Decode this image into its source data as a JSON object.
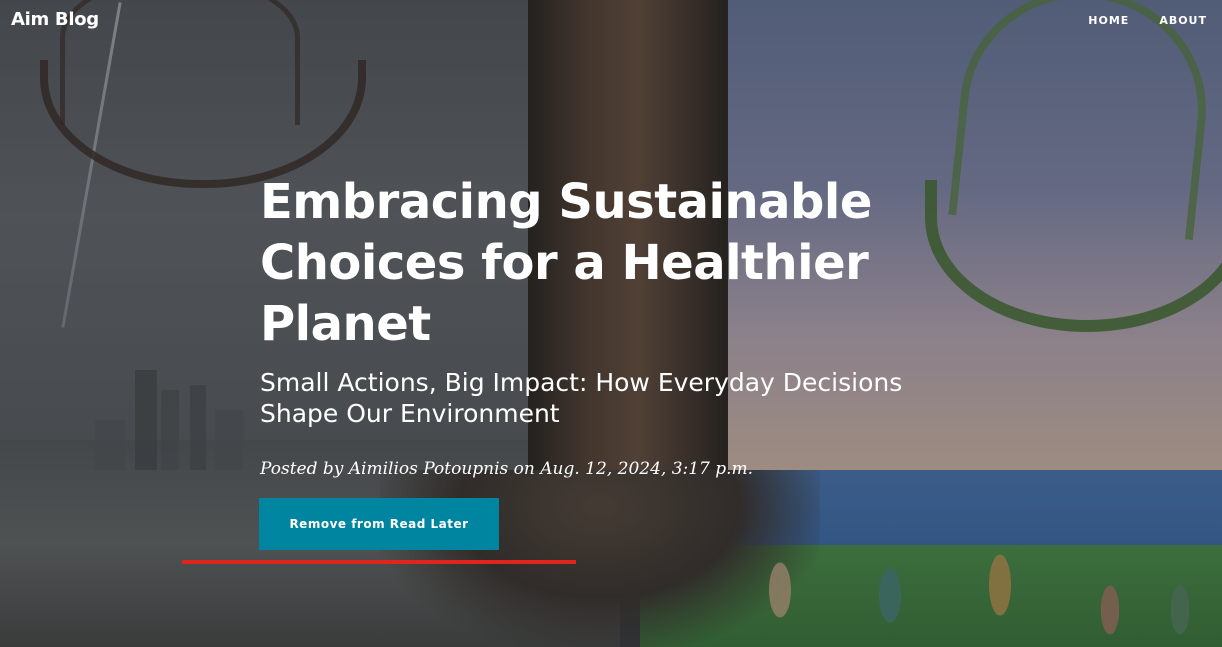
{
  "header": {
    "brand": "Aim Blog",
    "nav": [
      {
        "label": "HOME"
      },
      {
        "label": "ABOUT"
      }
    ]
  },
  "post": {
    "title": "Embracing Sustainable Choices for a Healthier Planet",
    "subtitle": "Small Actions, Big Impact: How Everyday Decisions Shape Our Environment",
    "meta": "Posted by Aimilios Potoupnis on Aug. 12, 2024, 3:17 p.m.",
    "read_later_button": "Remove from Read Later"
  },
  "colors": {
    "button": "#0085a1",
    "underline": "#e0251f"
  }
}
